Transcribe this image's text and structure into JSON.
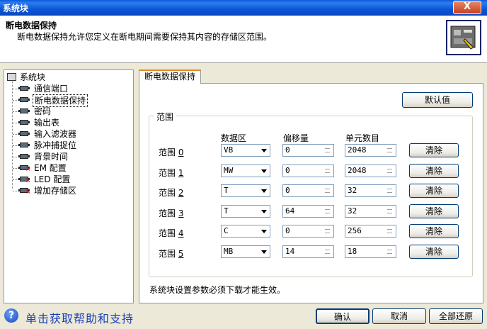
{
  "window": {
    "title": "系统块",
    "close_label": "X"
  },
  "header": {
    "title": "断电数据保持",
    "description": "断电数据保持允许您定义在断电期间需要保持其内容的存储区范围。"
  },
  "tree": {
    "root": "系统块",
    "items": [
      {
        "label": "通信端口",
        "warn": false
      },
      {
        "label": "断电数据保持",
        "warn": false,
        "selected": true
      },
      {
        "label": "密码",
        "warn": false
      },
      {
        "label": "输出表",
        "warn": false
      },
      {
        "label": "输入滤波器",
        "warn": false
      },
      {
        "label": "脉冲捕捉位",
        "warn": false
      },
      {
        "label": "背景时间",
        "warn": false
      },
      {
        "label": "EM 配置",
        "warn": true
      },
      {
        "label": "LED 配置",
        "warn": true
      },
      {
        "label": "增加存储区",
        "warn": true
      }
    ]
  },
  "tab": {
    "label": "断电数据保持"
  },
  "buttons": {
    "default": "默认值",
    "ok": "确认",
    "cancel": "取消",
    "restore_all": "全部还原",
    "clear": "清除"
  },
  "group": {
    "title": "范围"
  },
  "columns": {
    "data_area": "数据区",
    "offset": "偏移量",
    "count": "单元数目"
  },
  "ranges": [
    {
      "label": "范围",
      "index": "0",
      "area": "VB",
      "offset": "0",
      "count": "2048"
    },
    {
      "label": "范围",
      "index": "1",
      "area": "MW",
      "offset": "0",
      "count": "2048"
    },
    {
      "label": "范围",
      "index": "2",
      "area": "T",
      "offset": "0",
      "count": "32"
    },
    {
      "label": "范围",
      "index": "3",
      "area": "T",
      "offset": "64",
      "count": "32"
    },
    {
      "label": "范围",
      "index": "4",
      "area": "C",
      "offset": "0",
      "count": "256"
    },
    {
      "label": "范围",
      "index": "5",
      "area": "MB",
      "offset": "14",
      "count": "18"
    }
  ],
  "note": "系统块设置参数必须下载才能生效。",
  "help": {
    "icon": "?",
    "label": "单击获取帮助和支持"
  }
}
